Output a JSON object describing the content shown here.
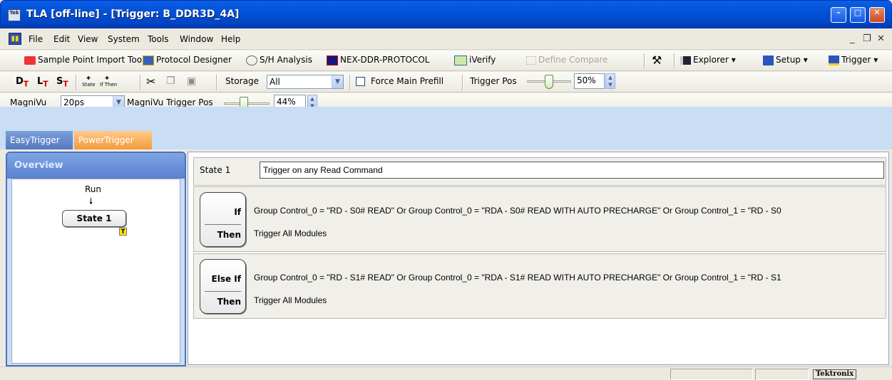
{
  "window": {
    "title": "TLA [off-line] - [Trigger: B_DDR3D_4A]",
    "icon_text": "Tek"
  },
  "menu": {
    "items": [
      "File",
      "Edit",
      "View",
      "System",
      "Tools",
      "Window",
      "Help"
    ]
  },
  "toolbar1": {
    "sample_point": "Sample Point Import Tool",
    "protocol_designer": "Protocol Designer",
    "sh_analysis": "S/H Analysis",
    "nex": "NEX-DDR-PROTOCOL",
    "iverify": "iVerify",
    "define_compare": "Define Compare",
    "explorer": "Explorer",
    "setup": "Setup",
    "trigger": "Trigger"
  },
  "toolbar2": {
    "dt": "D",
    "lt": "L",
    "st": "S",
    "state_label": "State",
    "ifthen_label": "If Then",
    "storage_label": "Storage",
    "storage_value": "All",
    "force_main_prefill": "Force Main Prefill",
    "trigger_pos_label": "Trigger Pos",
    "trigger_pos_value": "50%",
    "trigger_pos_fraction": 0.5
  },
  "toolbar3": {
    "magnivu_label": "MagniVu",
    "magnivu_value": "20ps",
    "magnivu_trigger_pos_label": "MagniVu Trigger Pos",
    "magnivu_trigger_pos_value": "44%",
    "magnivu_trigger_pos_fraction": 0.44
  },
  "tabs": {
    "easy": "EasyTrigger",
    "power": "PowerTrigger"
  },
  "overview": {
    "header": "Overview",
    "run": "Run",
    "state_node": "State 1",
    "trigger_marker": "T"
  },
  "state": {
    "title": "State 1",
    "description": "Trigger on any Read Command",
    "clauses": [
      {
        "keyword": "If",
        "then": "Then",
        "condition": "Group Control_0 = \"RD - S0# READ\" Or Group Control_0 = \"RDA - S0# READ WITH AUTO PRECHARGE\" Or Group Control_1 = \"RD - S0",
        "action": "Trigger All Modules"
      },
      {
        "keyword": "Else If",
        "then": "Then",
        "condition": "Group Control_0 = \"RD - S1# READ\" Or Group Control_0 = \"RDA - S1# READ WITH AUTO PRECHARGE\" Or Group Control_1 = \"RD - S1",
        "action": "Trigger All Modules"
      }
    ]
  },
  "status": {
    "logo": "Tektronix"
  },
  "colors": {
    "titlebar": "#0352d6",
    "power_tab": "#f29b3a",
    "easy_tab": "#5479c2",
    "panel_bg": "#c9ddf4"
  }
}
